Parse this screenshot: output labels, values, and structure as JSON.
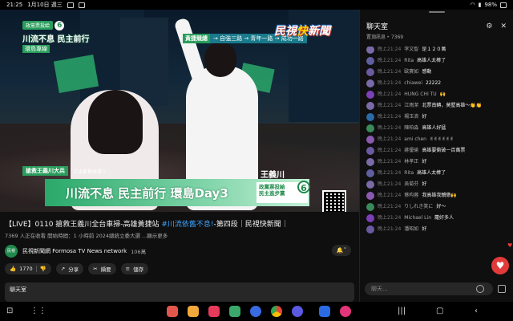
{
  "status_bar": {
    "time": "21:25",
    "date": "1月10日 週三",
    "battery": "98%"
  },
  "video": {
    "logo_line1": "政黨票投給",
    "logo_number": "6",
    "logo_line2": "川流不息 民主前行",
    "logo_line3": "環島專線",
    "ticker_tag": "黃捷競總",
    "ticker_route": "→ 自強三路 → 青年一路 → 成功一路",
    "brand_pre": "民視",
    "brand_kuai": "快",
    "brand_post": "新聞",
    "lt_chip": "搶救王義川大兵",
    "lt_candidate_tag": "立法委員候選人",
    "lt_name": "王義川",
    "lt_main": "川流不息 民主前行 環島Day3",
    "lt_party_line1": "政黨票投給",
    "lt_party_line2": "民主進步黨",
    "lt_party_number": "6"
  },
  "info": {
    "title_prefix": "【LIVE】0110 搶救王義川全台車掃-高雄黃捷站 ",
    "title_hashtag": "#川流依舊不息!",
    "title_suffix": "-第四段｜民視快新聞｜",
    "meta": "7369 人正在收看  開始時間：1 小時前  2024總統立委大選 ...顯示更多",
    "channel_avatar": "民視",
    "channel_name": "民視新聞網 Formosa TV News network",
    "channel_subs": "106萬",
    "likes": "1770",
    "share_label": "分享",
    "save_label": "儲存",
    "clip_label": "擷要",
    "chat_header": "聊天室"
  },
  "chat": {
    "title": "聊天室",
    "subtitle": "置頂訊息  ⁍ 7369",
    "input_placeholder": "聊天...",
    "messages": [
      {
        "time": "晚上21:24",
        "author": "李文智",
        "text": "是１２０萬",
        "color": "#7a6aa8"
      },
      {
        "time": "晚上21:24",
        "author": "Rita",
        "text": "高雄人太棒了",
        "color": "#5f5f9f"
      },
      {
        "time": "晚上21:24",
        "author": "歐寶如",
        "text": "感動",
        "color": "#6a5aa0"
      },
      {
        "time": "晚上21:24",
        "author": "chiawei",
        "text": "22222",
        "color": "#7a6aa8"
      },
      {
        "time": "晚上21:24",
        "author": "HUNG CHI TU",
        "text": "🙌",
        "color": "#7b3fb8"
      },
      {
        "time": "晚上21:24",
        "author": "江雨潔",
        "text": "北票南轉，莫墅高雄～👏👏",
        "color": "#7a6aa8"
      },
      {
        "time": "晚上21:24",
        "author": "楊玉濟",
        "text": "好",
        "color": "#2a6aa8"
      },
      {
        "time": "晚上21:24",
        "author": "陳柏淼",
        "text": "高雄人好猛",
        "color": "#3a8a5a"
      },
      {
        "time": "晚上21:24",
        "author": "ami chen",
        "text": "✌✌✌✌✌✌",
        "color": "#8a5ab0"
      },
      {
        "time": "晚上21:24",
        "author": "蔣優瑜",
        "text": "高雄要衝破一百萬票",
        "color": "#6a5aa0"
      },
      {
        "time": "晚上21:24",
        "author": "林孝正",
        "text": "好",
        "color": "#7a6aa8"
      },
      {
        "time": "晚上21:24",
        "author": "Rita",
        "text": "高雄人太棒了",
        "color": "#5f5f9f"
      },
      {
        "time": "晚上21:24",
        "author": "吳菊芬",
        "text": "好",
        "color": "#7a6aa8"
      },
      {
        "time": "晚上21:24",
        "author": "蔡昀蓉",
        "text": "我高雄我驕傲🙌",
        "color": "#8a5ab0"
      },
      {
        "time": "晚上21:24",
        "author": "りしれき笑に",
        "text": "好～",
        "color": "#3a8a5a"
      },
      {
        "time": "晚上21:24",
        "author": "Michael Lin",
        "text": "蘿好多人",
        "color": "#7b3fb8"
      },
      {
        "time": "晚上21:24",
        "author": "潘昭如",
        "text": "好",
        "color": "#6a5aa0"
      }
    ]
  }
}
